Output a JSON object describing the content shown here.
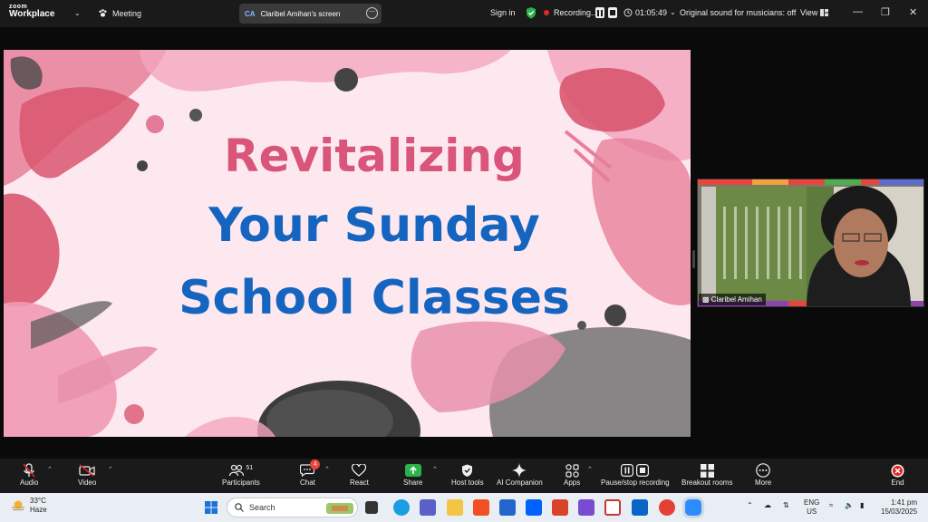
{
  "titlebar": {
    "logo_top": "zoom",
    "logo_bottom": "Workplace",
    "meeting_label": "Meeting",
    "screen_initials": "CA",
    "screen_label": "Claribel Amihan's screen",
    "sign_in": "Sign in",
    "recording_label": "Recording...",
    "timer": "01:05:49",
    "sound_label": "Original sound for musicians: off",
    "view_label": "View"
  },
  "slide": {
    "line1": "Revitalizing",
    "line2": "Your Sunday",
    "line3": "School Classes"
  },
  "video": {
    "participant_name": "Claribel Amihan"
  },
  "controls": {
    "audio": "Audio",
    "video": "Video",
    "participants": "Participants",
    "participants_count": "51",
    "chat": "Chat",
    "chat_badge": "4",
    "react": "React",
    "share": "Share",
    "host_tools": "Host tools",
    "ai_companion": "AI Companion",
    "apps": "Apps",
    "pause_stop": "Pause/stop recording",
    "breakout": "Breakout rooms",
    "more": "More",
    "end": "End"
  },
  "taskbar": {
    "temp": "33°C",
    "condition": "Haze",
    "search_placeholder": "Search",
    "lang_top": "ENG",
    "lang_bottom": "US",
    "time": "1:41 pm",
    "date": "15/03/2025"
  },
  "colors": {
    "title_pink": "#d9557a",
    "title_blue": "#1565c0",
    "share_green": "#2bb24c",
    "end_red": "#e02828",
    "badge_red": "#e8453c"
  }
}
